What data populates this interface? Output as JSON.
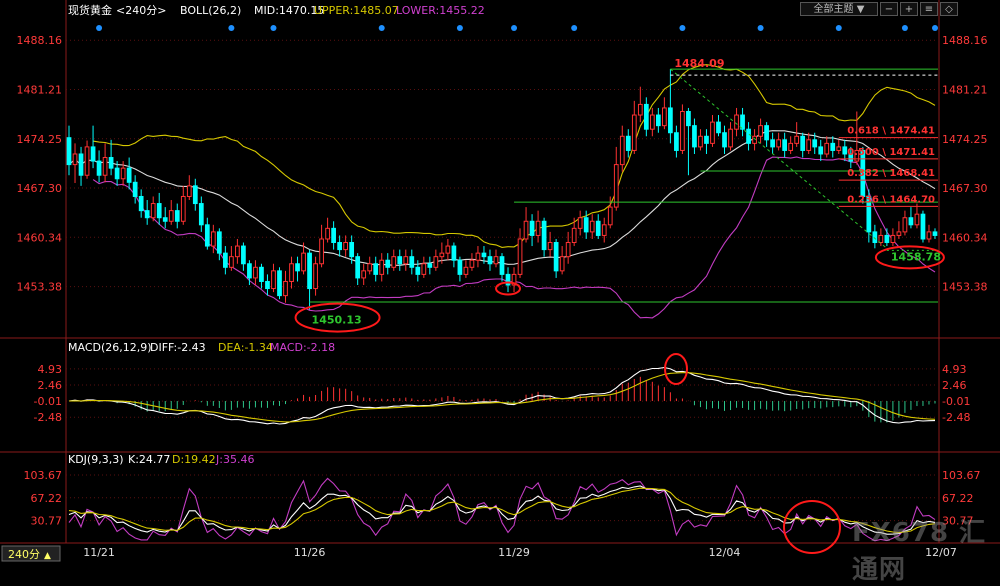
{
  "header": {
    "symbol": "现货黄金",
    "period": "<240分>",
    "boll_label": "BOLL(26,2)",
    "mid": "MID:1470.15",
    "upper": "UPPER:1485.07",
    "lower": "LOWER:1455.22",
    "menu": "全部主题",
    "menu_arrow": "▼"
  },
  "macd_header": {
    "label": "MACD(26,12,9)",
    "diff": "DIFF:-2.43",
    "dea": "DEA:-1.34",
    "macd": "MACD:-2.18"
  },
  "kdj_header": {
    "label": "KDJ(9,3,3)",
    "k": "K:24.77",
    "d": "D:19.42",
    "j": "J:35.46"
  },
  "period_tab": "240分",
  "period_arrow": "▲",
  "watermark": "FX678 汇通网",
  "colors": {
    "up": "#ff3232",
    "down": "#00ffff",
    "price_axis": "#ff3a3a",
    "mid_line": "#dcdcdc",
    "upper_line": "#d6c800",
    "lower_line": "#c23cc2",
    "fib_line": "#ff3232",
    "support_line": "#2ec52e",
    "dot": "#1e90ff",
    "grid": "#5a1010"
  },
  "chart_data": {
    "type": "candlestick",
    "price_axis": {
      "ticks": [
        "1488.16",
        "1481.21",
        "1474.25",
        "1467.30",
        "1460.34",
        "1453.38"
      ],
      "ylim": [
        1446.4,
        1491.3
      ]
    },
    "macd_axis": {
      "ticks": [
        "4.93",
        "2.46",
        "-0.01",
        "-2.48"
      ],
      "ylim": [
        -7.5,
        7.2
      ]
    },
    "kdj_axis": {
      "ticks": [
        "103.67",
        "67.22",
        "30.77"
      ],
      "ylim": [
        -5,
        118
      ]
    },
    "x_labels": [
      {
        "label": "11/21",
        "bar": 5
      },
      {
        "label": "11/26",
        "bar": 40
      },
      {
        "label": "11/29",
        "bar": 74
      },
      {
        "label": "12/04",
        "bar": 109
      },
      {
        "label": "12/07",
        "bar": 145
      }
    ],
    "candles": [
      [
        1474.4,
        1470.6,
        1476.1,
        1469.1
      ],
      [
        1470.6,
        1472.1,
        1473.6,
        1468.0
      ],
      [
        1472.1,
        1469.1,
        1473.1,
        1467.6
      ],
      [
        1469.1,
        1473.1,
        1474.0,
        1468.6
      ],
      [
        1473.1,
        1471.1,
        1476.1,
        1470.1
      ],
      [
        1471.1,
        1469.1,
        1472.6,
        1468.1
      ],
      [
        1469.1,
        1471.6,
        1473.6,
        1468.1
      ],
      [
        1471.6,
        1470.1,
        1474.1,
        1469.1
      ],
      [
        1470.1,
        1468.6,
        1471.1,
        1467.6
      ],
      [
        1468.6,
        1470.1,
        1471.1,
        1467.6
      ],
      [
        1470.1,
        1468.1,
        1471.6,
        1467.1
      ],
      [
        1468.1,
        1466.1,
        1469.1,
        1465.1
      ],
      [
        1466.1,
        1464.1,
        1467.1,
        1463.1
      ],
      [
        1464.1,
        1463.1,
        1465.6,
        1462.1
      ],
      [
        1463.1,
        1465.1,
        1466.1,
        1462.6
      ],
      [
        1465.1,
        1463.1,
        1466.6,
        1462.1
      ],
      [
        1463.1,
        1462.6,
        1464.6,
        1461.6
      ],
      [
        1462.6,
        1464.1,
        1465.6,
        1462.1
      ],
      [
        1464.1,
        1462.6,
        1465.1,
        1461.6
      ],
      [
        1462.6,
        1466.1,
        1467.6,
        1462.1
      ],
      [
        1466.1,
        1467.6,
        1469.1,
        1465.6
      ],
      [
        1467.6,
        1465.1,
        1468.6,
        1464.1
      ],
      [
        1465.1,
        1462.1,
        1466.1,
        1461.1
      ],
      [
        1462.1,
        1459.1,
        1463.1,
        1458.6
      ],
      [
        1459.1,
        1461.1,
        1462.1,
        1458.1
      ],
      [
        1461.1,
        1458.1,
        1461.6,
        1457.1
      ],
      [
        1458.1,
        1456.1,
        1459.1,
        1455.1
      ],
      [
        1456.1,
        1457.6,
        1459.1,
        1455.6
      ],
      [
        1457.6,
        1459.1,
        1460.1,
        1456.6
      ],
      [
        1459.1,
        1456.6,
        1459.6,
        1455.6
      ],
      [
        1456.6,
        1454.6,
        1457.1,
        1453.6
      ],
      [
        1454.6,
        1456.1,
        1457.1,
        1453.6
      ],
      [
        1456.1,
        1454.1,
        1456.6,
        1453.1
      ],
      [
        1454.1,
        1453.1,
        1455.1,
        1452.1
      ],
      [
        1453.1,
        1455.6,
        1456.6,
        1452.6
      ],
      [
        1455.6,
        1452.1,
        1456.1,
        1451.6
      ],
      [
        1452.1,
        1454.1,
        1455.6,
        1451.1
      ],
      [
        1454.1,
        1456.6,
        1457.6,
        1453.1
      ],
      [
        1456.6,
        1455.6,
        1457.6,
        1454.1
      ],
      [
        1455.6,
        1458.1,
        1459.6,
        1455.1
      ],
      [
        1458.1,
        1453.1,
        1458.6,
        1450.13
      ],
      [
        1453.1,
        1456.6,
        1457.6,
        1452.1
      ],
      [
        1456.6,
        1460.1,
        1462.1,
        1456.1
      ],
      [
        1460.1,
        1461.6,
        1463.1,
        1459.6
      ],
      [
        1461.6,
        1459.6,
        1462.6,
        1458.6
      ],
      [
        1459.6,
        1458.6,
        1460.6,
        1457.6
      ],
      [
        1458.6,
        1459.6,
        1460.6,
        1457.6
      ],
      [
        1459.6,
        1457.6,
        1460.6,
        1456.6
      ],
      [
        1457.6,
        1454.6,
        1458.1,
        1453.6
      ],
      [
        1454.6,
        1455.6,
        1456.6,
        1453.6
      ],
      [
        1455.6,
        1456.6,
        1457.6,
        1455.1
      ],
      [
        1456.6,
        1455.1,
        1457.6,
        1454.1
      ],
      [
        1455.1,
        1457.1,
        1458.1,
        1454.1
      ],
      [
        1457.1,
        1456.1,
        1458.1,
        1455.1
      ],
      [
        1456.1,
        1457.6,
        1458.6,
        1455.6
      ],
      [
        1457.6,
        1456.6,
        1458.6,
        1455.6
      ],
      [
        1456.6,
        1457.6,
        1458.6,
        1455.6
      ],
      [
        1457.6,
        1456.1,
        1458.6,
        1455.1
      ],
      [
        1456.1,
        1455.1,
        1457.1,
        1454.1
      ],
      [
        1455.1,
        1456.6,
        1457.6,
        1454.6
      ],
      [
        1456.6,
        1456.1,
        1457.6,
        1455.1
      ],
      [
        1456.1,
        1457.6,
        1458.6,
        1455.6
      ],
      [
        1457.6,
        1458.1,
        1459.6,
        1456.6
      ],
      [
        1458.1,
        1459.1,
        1460.1,
        1457.1
      ],
      [
        1459.1,
        1457.1,
        1459.6,
        1456.1
      ],
      [
        1457.1,
        1455.1,
        1457.6,
        1454.1
      ],
      [
        1455.1,
        1456.1,
        1457.1,
        1454.6
      ],
      [
        1456.1,
        1457.1,
        1458.1,
        1455.6
      ],
      [
        1457.1,
        1458.1,
        1459.1,
        1456.1
      ],
      [
        1458.1,
        1457.6,
        1459.1,
        1456.6
      ],
      [
        1457.6,
        1456.6,
        1458.6,
        1455.6
      ],
      [
        1456.6,
        1457.6,
        1458.6,
        1456.1
      ],
      [
        1457.6,
        1455.1,
        1458.1,
        1454.1
      ],
      [
        1455.1,
        1453.6,
        1456.1,
        1452.6
      ],
      [
        1453.6,
        1455.1,
        1456.1,
        1452.6
      ],
      [
        1455.1,
        1460.1,
        1461.6,
        1454.6
      ],
      [
        1460.1,
        1462.6,
        1464.6,
        1459.6
      ],
      [
        1462.6,
        1460.6,
        1463.6,
        1459.1
      ],
      [
        1460.6,
        1462.6,
        1464.1,
        1459.6
      ],
      [
        1462.6,
        1458.6,
        1463.1,
        1457.6
      ],
      [
        1458.6,
        1459.6,
        1461.1,
        1457.6
      ],
      [
        1459.6,
        1455.6,
        1460.1,
        1454.6
      ],
      [
        1455.6,
        1457.6,
        1459.1,
        1455.1
      ],
      [
        1457.6,
        1459.6,
        1461.1,
        1456.6
      ],
      [
        1459.6,
        1461.6,
        1463.1,
        1459.1
      ],
      [
        1461.6,
        1463.1,
        1464.1,
        1460.6
      ],
      [
        1463.1,
        1461.1,
        1464.1,
        1460.1
      ],
      [
        1461.1,
        1462.6,
        1463.6,
        1460.1
      ],
      [
        1462.6,
        1460.6,
        1463.6,
        1460.1
      ],
      [
        1460.6,
        1462.1,
        1463.1,
        1459.6
      ],
      [
        1462.1,
        1464.6,
        1466.1,
        1461.6
      ],
      [
        1464.6,
        1470.6,
        1473.1,
        1464.1
      ],
      [
        1470.6,
        1474.6,
        1476.1,
        1469.6
      ],
      [
        1474.6,
        1472.6,
        1475.6,
        1471.6
      ],
      [
        1472.6,
        1477.6,
        1479.6,
        1472.1
      ],
      [
        1477.6,
        1479.1,
        1481.6,
        1476.6
      ],
      [
        1479.1,
        1475.6,
        1480.1,
        1474.6
      ],
      [
        1475.6,
        1477.6,
        1478.6,
        1474.6
      ],
      [
        1477.6,
        1476.1,
        1478.6,
        1475.1
      ],
      [
        1476.1,
        1478.6,
        1480.1,
        1475.6
      ],
      [
        1478.6,
        1475.1,
        1484.09,
        1473.6
      ],
      [
        1475.1,
        1472.6,
        1476.1,
        1471.6
      ],
      [
        1472.6,
        1478.1,
        1479.1,
        1472.1
      ],
      [
        1478.1,
        1476.1,
        1478.6,
        1469.1
      ],
      [
        1476.1,
        1473.1,
        1477.1,
        1472.1
      ],
      [
        1473.1,
        1474.6,
        1475.6,
        1472.6
      ],
      [
        1474.6,
        1473.6,
        1475.6,
        1472.1
      ],
      [
        1473.6,
        1476.6,
        1477.6,
        1473.1
      ],
      [
        1476.6,
        1475.1,
        1477.6,
        1474.6
      ],
      [
        1475.1,
        1473.1,
        1476.1,
        1472.1
      ],
      [
        1473.1,
        1475.6,
        1476.6,
        1472.6
      ],
      [
        1475.6,
        1477.6,
        1478.6,
        1474.6
      ],
      [
        1477.6,
        1475.6,
        1478.6,
        1474.6
      ],
      [
        1475.6,
        1473.6,
        1476.6,
        1472.6
      ],
      [
        1473.6,
        1474.6,
        1475.6,
        1472.6
      ],
      [
        1474.6,
        1476.1,
        1477.1,
        1473.6
      ],
      [
        1476.1,
        1474.1,
        1476.6,
        1473.1
      ],
      [
        1474.1,
        1473.1,
        1475.1,
        1472.1
      ],
      [
        1473.1,
        1474.1,
        1475.1,
        1472.6
      ],
      [
        1474.1,
        1472.6,
        1475.1,
        1471.6
      ],
      [
        1472.6,
        1473.6,
        1474.6,
        1472.1
      ],
      [
        1473.6,
        1474.6,
        1476.6,
        1473.1
      ],
      [
        1474.6,
        1472.6,
        1475.1,
        1471.6
      ],
      [
        1472.6,
        1474.1,
        1475.1,
        1472.1
      ],
      [
        1474.1,
        1473.1,
        1475.1,
        1472.1
      ],
      [
        1473.1,
        1472.1,
        1474.1,
        1471.1
      ],
      [
        1472.1,
        1473.6,
        1474.6,
        1471.6
      ],
      [
        1473.6,
        1472.6,
        1474.6,
        1471.6
      ],
      [
        1472.6,
        1473.1,
        1474.1,
        1472.1
      ],
      [
        1473.1,
        1472.1,
        1474.1,
        1471.1
      ],
      [
        1472.1,
        1471.1,
        1473.1,
        1470.1
      ],
      [
        1471.1,
        1472.6,
        1478.1,
        1470.6
      ],
      [
        1472.6,
        1466.1,
        1473.1,
        1465.1
      ],
      [
        1466.1,
        1461.1,
        1467.1,
        1459.6
      ],
      [
        1461.1,
        1459.6,
        1462.1,
        1458.78
      ],
      [
        1459.6,
        1460.6,
        1461.6,
        1459.1
      ],
      [
        1460.6,
        1459.6,
        1461.6,
        1459.1
      ],
      [
        1459.6,
        1460.6,
        1461.6,
        1459.1
      ],
      [
        1460.6,
        1461.1,
        1462.6,
        1460.1
      ],
      [
        1461.1,
        1463.1,
        1464.1,
        1460.6
      ],
      [
        1463.1,
        1462.1,
        1464.6,
        1461.6
      ],
      [
        1462.1,
        1463.6,
        1465.1,
        1461.6
      ],
      [
        1463.6,
        1460.1,
        1464.1,
        1459.6
      ],
      [
        1460.1,
        1461.1,
        1462.1,
        1459.6
      ],
      [
        1461.1,
        1460.6,
        1461.6,
        1460.1
      ]
    ],
    "bar_count": 150,
    "last_values": {
      "mid": 1470.15,
      "upper": 1485.07,
      "lower": 1455.22,
      "diff": -2.43,
      "dea": -1.34,
      "macd": -2.18,
      "k": 24.77,
      "d": 19.42,
      "j": 35.46
    },
    "annotations": [
      {
        "label": "1484.09",
        "price": 1484.09,
        "type": "high"
      },
      {
        "label": "1458.78",
        "price": 1458.78,
        "type": "low"
      },
      {
        "label": "1450.13",
        "price": 1450.13,
        "type": "low"
      }
    ],
    "fibonacci": [
      {
        "label": "0.618 \\ 1474.41",
        "price": 1474.41
      },
      {
        "label": "0.500 \\ 1471.41",
        "price": 1471.41
      },
      {
        "label": "0.382 \\ 1468.41",
        "price": 1468.41
      },
      {
        "label": "0.236 \\ 1464.70",
        "price": 1464.7
      }
    ],
    "support_lines": [
      1484.09,
      1469.7,
      1465.3,
      1451.2
    ],
    "event_dot_bars": [
      5,
      27,
      34,
      52,
      65,
      74,
      84,
      102,
      115,
      128,
      139,
      144
    ]
  }
}
